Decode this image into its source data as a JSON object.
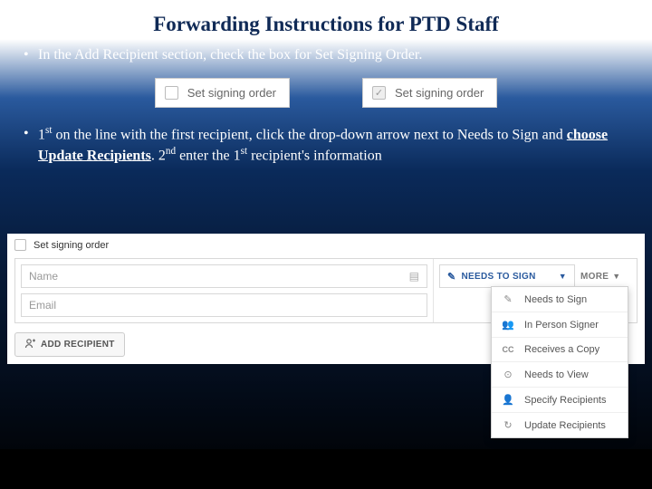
{
  "title": "Forwarding Instructions for PTD Staff",
  "bullets": {
    "b1": "In the Add Recipient section, check the box for Set Signing Order.",
    "b2_pre": "1",
    "b2_sup1": "st",
    "b2_mid1": "  on the line with the first recipient, click the drop-down arrow next to Needs to Sign and ",
    "b2_u": "choose Update Recipients",
    "b2_mid2": ". 2",
    "b2_sup2": "nd",
    "b2_mid3": " enter the 1",
    "b2_sup3": "st",
    "b2_end": " recipient's information"
  },
  "inset": {
    "unchecked_label": "Set signing order",
    "checked_label": "Set signing order"
  },
  "panel": {
    "set_order_label": "Set signing order",
    "name_placeholder": "Name",
    "email_placeholder": "Email",
    "needs_to_sign": "NEEDS TO SIGN",
    "more": "MORE",
    "add_recipient": "ADD RECIPIENT"
  },
  "dropdown": {
    "items": [
      {
        "icon": "✎",
        "label": "Needs to Sign"
      },
      {
        "icon": "👥",
        "label": "In Person Signer"
      },
      {
        "icon": "CC",
        "label": "Receives a Copy"
      },
      {
        "icon": "⊙",
        "label": "Needs to View"
      },
      {
        "icon": "👤",
        "label": "Specify Recipients"
      },
      {
        "icon": "↻",
        "label": "Update Recipients"
      }
    ]
  }
}
